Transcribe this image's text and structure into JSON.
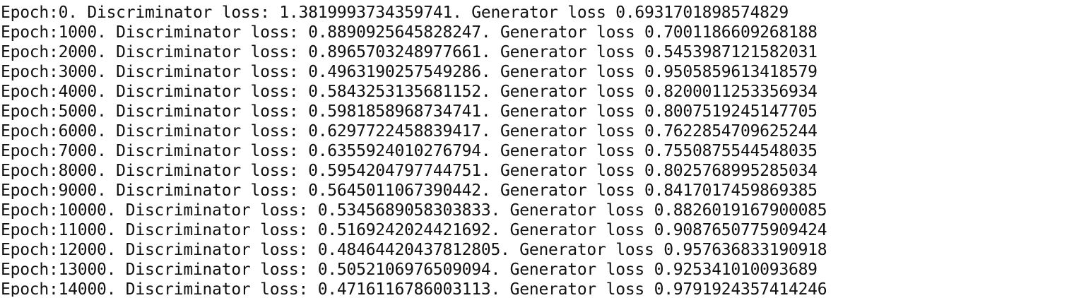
{
  "terminal": {
    "lines": [
      "Epoch:0. Discriminator loss: 1.3819993734359741. Generator loss 0.6931701898574829",
      "Epoch:1000. Discriminator loss: 0.8890925645828247. Generator loss 0.7001186609268188",
      "Epoch:2000. Discriminator loss: 0.8965703248977661. Generator loss 0.5453987121582031",
      "Epoch:3000. Discriminator loss: 0.4963190257549286. Generator loss 0.9505859613418579",
      "Epoch:4000. Discriminator loss: 0.5843253135681152. Generator loss 0.8200011253356934",
      "Epoch:5000. Discriminator loss: 0.5981858968734741. Generator loss 0.8007519245147705",
      "Epoch:6000. Discriminator loss: 0.6297722458839417. Generator loss 0.7622854709625244",
      "Epoch:7000. Discriminator loss: 0.6355924010276794. Generator loss 0.7550875544548035",
      "Epoch:8000. Discriminator loss: 0.5954204797744751. Generator loss 0.8025768995285034",
      "Epoch:9000. Discriminator loss: 0.5645011067390442. Generator loss 0.8417017459869385",
      "Epoch:10000. Discriminator loss: 0.5345689058303833. Generator loss 0.8826019167900085",
      "Epoch:11000. Discriminator loss: 0.5169242024421692. Generator loss 0.9087650775909424",
      "Epoch:12000. Discriminator loss: 0.48464420437812805. Generator loss 0.957636833190918",
      "Epoch:13000. Discriminator loss: 0.5052106976509094. Generator loss 0.925341010093689",
      "Epoch:14000. Discriminator loss: 0.4716116786003113. Generator loss 0.9791924357414246"
    ]
  }
}
